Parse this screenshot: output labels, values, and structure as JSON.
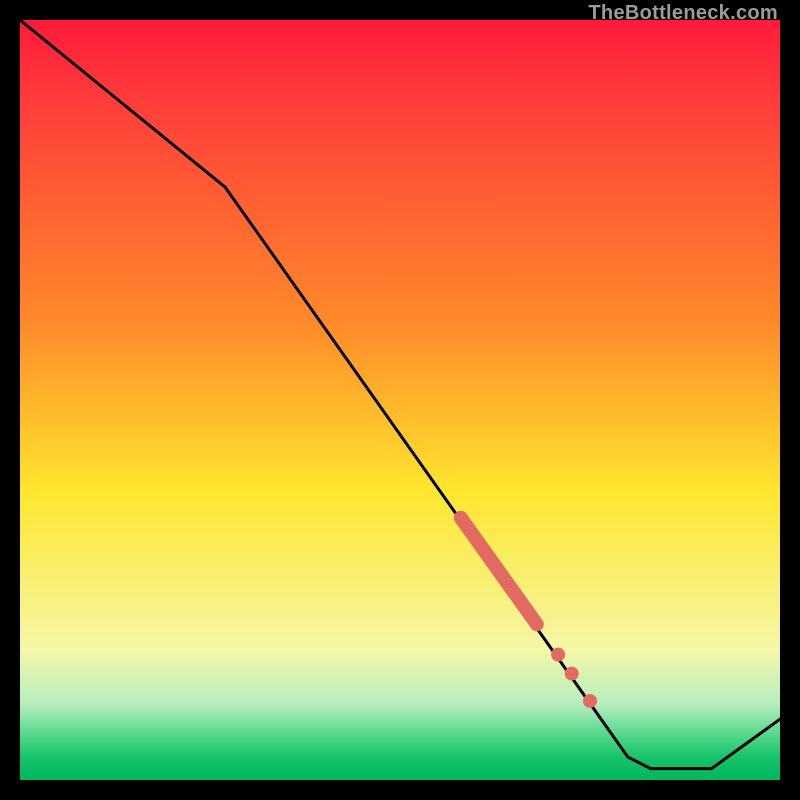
{
  "watermark": "TheBottleneck.com",
  "colors": {
    "background": "#000000",
    "line": "#000000",
    "marker": "#e36a62",
    "gradient_top": "#ff1a3a",
    "gradient_red": "#ff3b3b",
    "gradient_orange": "#ff8a2a",
    "gradient_yellow": "#ffe62e",
    "gradient_pale": "#f4f7a8",
    "gradient_mint": "#b6eec0",
    "gradient_green_a": "#4ad585",
    "gradient_green_b": "#17c26b",
    "gradient_green_c": "#00b65b"
  },
  "chart_data": {
    "type": "line",
    "title": "",
    "xlabel": "",
    "ylabel": "",
    "xlim": [
      0,
      100
    ],
    "ylim": [
      0,
      100
    ],
    "line_points": [
      {
        "x": 0,
        "y": 100
      },
      {
        "x": 27,
        "y": 78
      },
      {
        "x": 80,
        "y": 3
      },
      {
        "x": 83,
        "y": 1.5
      },
      {
        "x": 91,
        "y": 1.5
      },
      {
        "x": 100,
        "y": 8
      }
    ],
    "thick_segment": {
      "x1": 58,
      "y1": 34.5,
      "x2": 68,
      "y2": 20.5
    },
    "dots": [
      {
        "x": 70.8,
        "y": 16.5
      },
      {
        "x": 72.6,
        "y": 14.0
      },
      {
        "x": 75.0,
        "y": 10.4
      }
    ],
    "gradient_stops": [
      {
        "offset": 0.0,
        "key": "gradient_top"
      },
      {
        "offset": 0.1,
        "key": "gradient_red"
      },
      {
        "offset": 0.4,
        "key": "gradient_orange"
      },
      {
        "offset": 0.62,
        "key": "gradient_yellow"
      },
      {
        "offset": 0.83,
        "key": "gradient_pale"
      },
      {
        "offset": 0.9,
        "key": "gradient_mint"
      },
      {
        "offset": 0.945,
        "key": "gradient_green_a"
      },
      {
        "offset": 0.97,
        "key": "gradient_green_b"
      },
      {
        "offset": 1.0,
        "key": "gradient_green_c"
      }
    ]
  }
}
